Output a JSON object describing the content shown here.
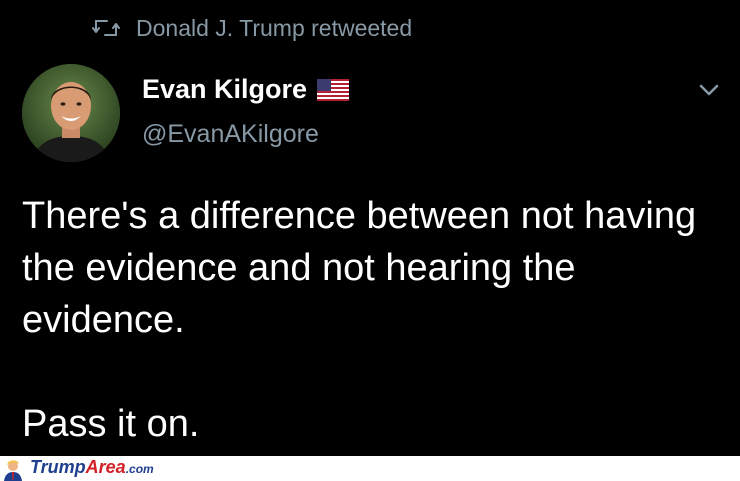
{
  "retweet": {
    "icon": "retweet-icon",
    "label": "Donald J. Trump retweeted"
  },
  "author": {
    "avatar": "avatar-photo",
    "name": "Evan Kilgore",
    "flag_icon": "us-flag-icon",
    "handle": "@EvanAKilgore"
  },
  "menu": {
    "icon": "chevron-down-icon"
  },
  "tweet": {
    "paragraph_1": "There's a difference between not having the evidence and not hearing the evidence.",
    "paragraph_2": "Pass it on."
  },
  "watermark": {
    "part_1": "Trump",
    "part_2": "Area",
    "part_3": ".com"
  },
  "colors": {
    "background": "#000000",
    "text": "#ffffff",
    "secondary": "#8899a6",
    "watermark_blue": "#1f3f8f",
    "watermark_red": "#d42027"
  }
}
